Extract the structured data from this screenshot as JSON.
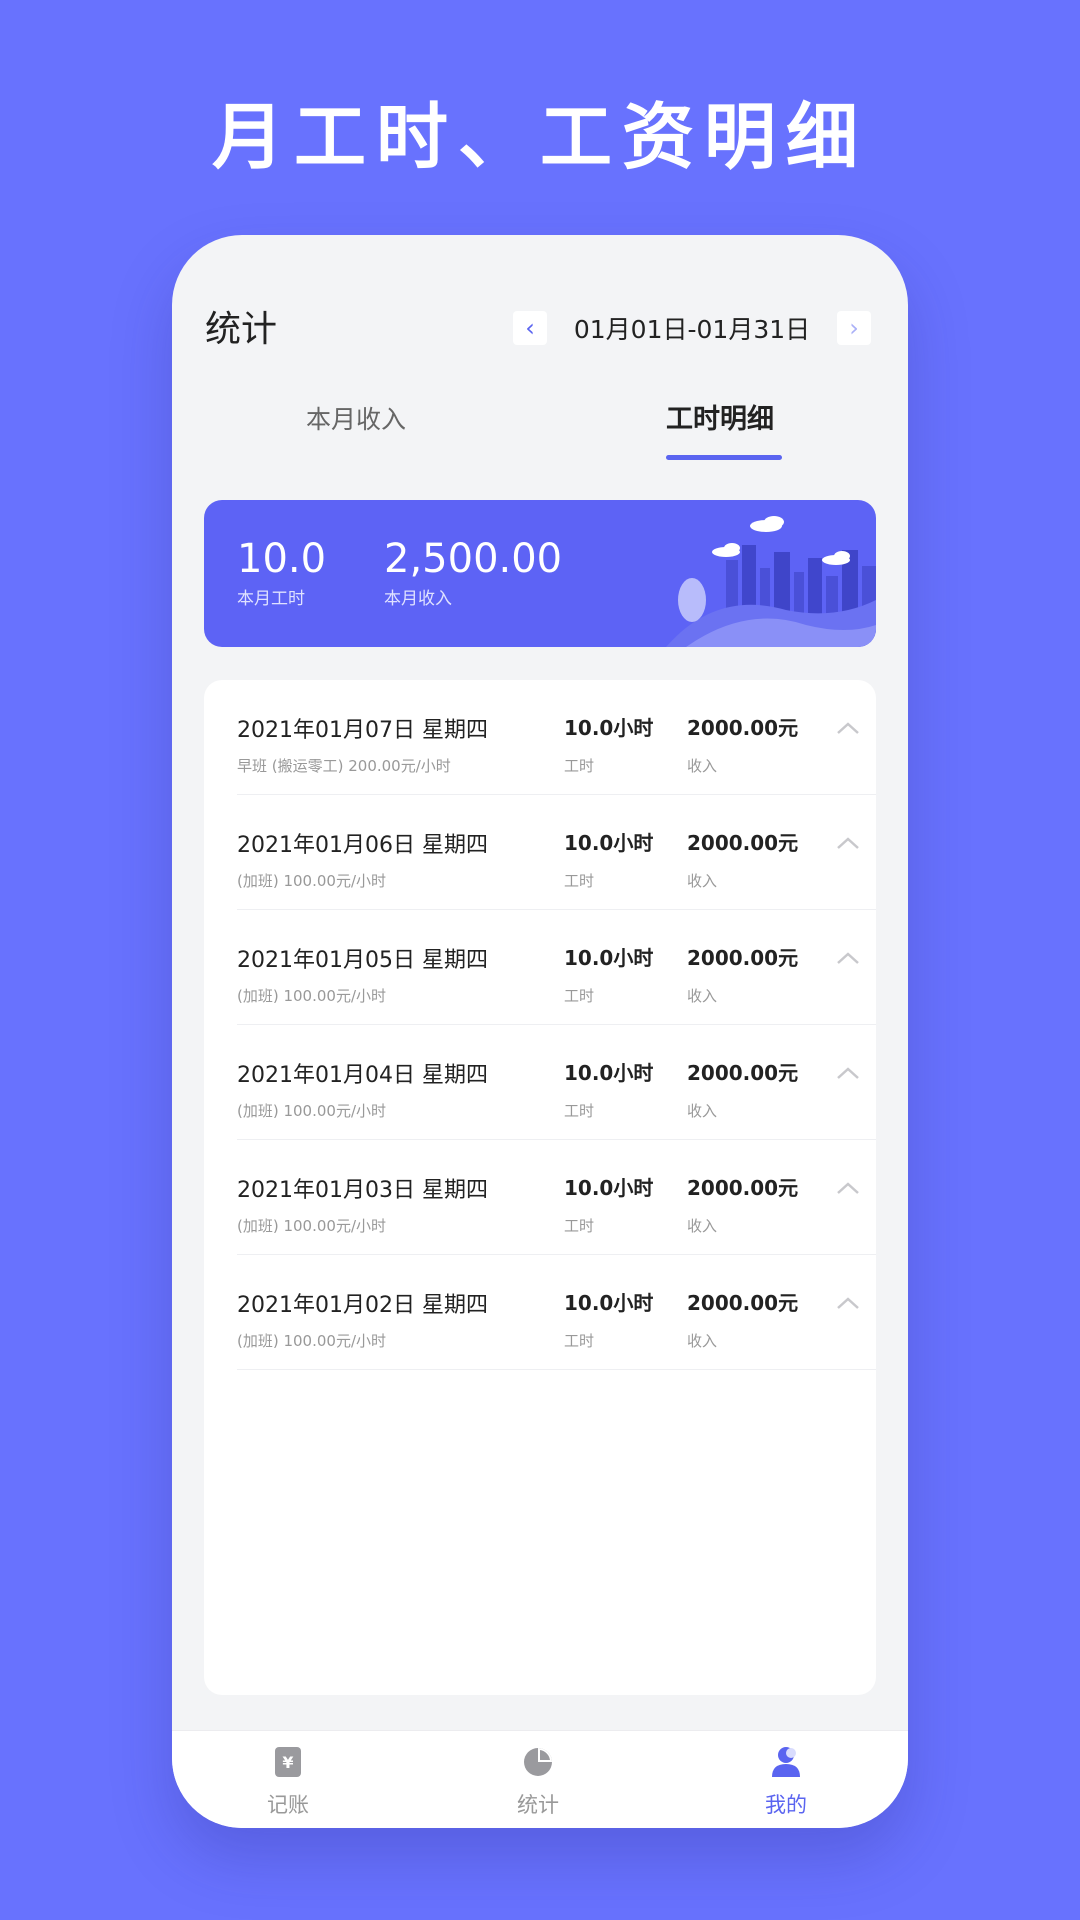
{
  "headline": "月工时、工资明细",
  "header": {
    "title": "统计",
    "prev_icon": "chevron-left-icon",
    "next_icon": "chevron-right-icon",
    "date_range": "01月01日-01月31日"
  },
  "tabs": [
    {
      "label": "本月收入",
      "active": false
    },
    {
      "label": "工时明细",
      "active": true
    }
  ],
  "summary": {
    "hours_value": "10.0",
    "hours_label": "本月工时",
    "income_value": "2,500.00",
    "income_label": "本月收入"
  },
  "records": [
    {
      "date": "2021年01月07日 星期四",
      "detail": "早班 (搬运零工)  200.00元/小时",
      "hours": "10.0小时",
      "hours_label": "工时",
      "amount": "2000.00元",
      "amount_label": "收入"
    },
    {
      "date": "2021年01月06日 星期四",
      "detail": "(加班)  100.00元/小时",
      "hours": "10.0小时",
      "hours_label": "工时",
      "amount": "2000.00元",
      "amount_label": "收入"
    },
    {
      "date": "2021年01月05日 星期四",
      "detail": "(加班)  100.00元/小时",
      "hours": "10.0小时",
      "hours_label": "工时",
      "amount": "2000.00元",
      "amount_label": "收入"
    },
    {
      "date": "2021年01月04日 星期四",
      "detail": "(加班)  100.00元/小时",
      "hours": "10.0小时",
      "hours_label": "工时",
      "amount": "2000.00元",
      "amount_label": "收入"
    },
    {
      "date": "2021年01月03日 星期四",
      "detail": "(加班)  100.00元/小时",
      "hours": "10.0小时",
      "hours_label": "工时",
      "amount": "2000.00元",
      "amount_label": "收入"
    },
    {
      "date": "2021年01月02日 星期四",
      "detail": "(加班)  100.00元/小时",
      "hours": "10.0小时",
      "hours_label": "工时",
      "amount": "2000.00元",
      "amount_label": "收入"
    }
  ],
  "tabbar": [
    {
      "label": "记账",
      "icon": "ledger-icon",
      "active": false
    },
    {
      "label": "统计",
      "icon": "pie-chart-icon",
      "active": false
    },
    {
      "label": "我的",
      "icon": "user-icon",
      "active": true
    }
  ],
  "colors": {
    "background": "#6872fe",
    "accent": "#5a64f0",
    "card": "#5d63f5"
  }
}
